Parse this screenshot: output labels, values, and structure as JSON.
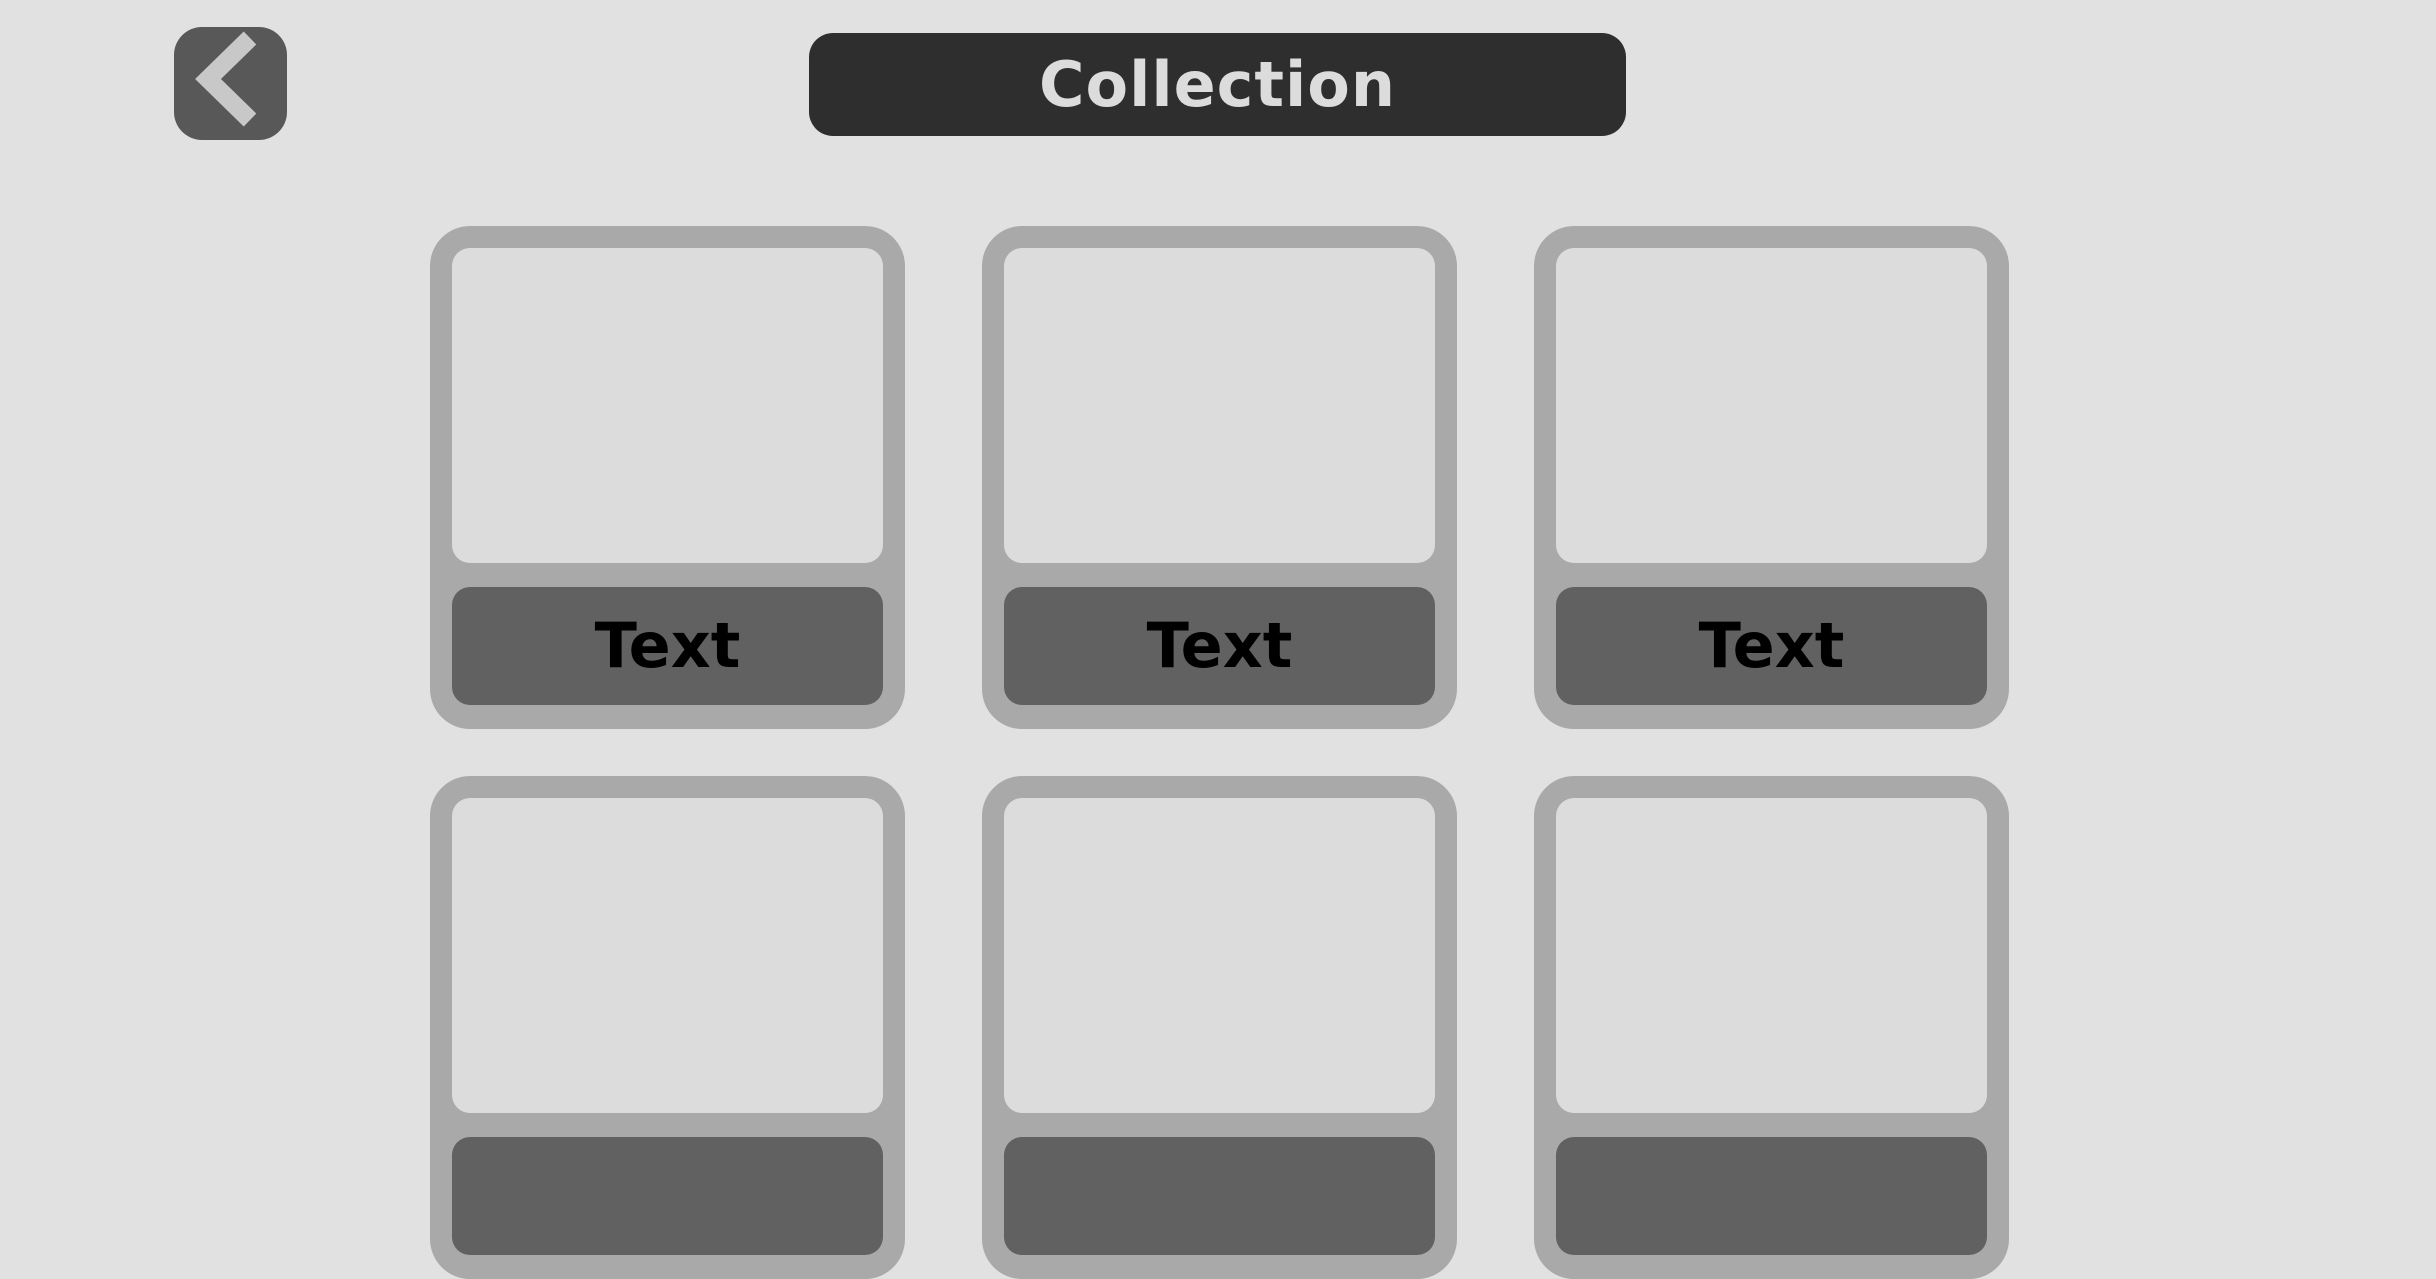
{
  "header": {
    "back_icon": "chevron-left-icon",
    "title": "Collection"
  },
  "colors": {
    "background": "#e1e1e1",
    "back_button": "#585858",
    "title_bar": "#2e2e2e",
    "title_text": "#dcdcdc",
    "card_frame": "#a9a9a9",
    "card_image": "#dcdcdc",
    "card_label": "#616161"
  },
  "collection": {
    "items": [
      {
        "label": "Text"
      },
      {
        "label": "Text"
      },
      {
        "label": "Text"
      },
      {
        "label": ""
      },
      {
        "label": ""
      },
      {
        "label": ""
      }
    ]
  }
}
